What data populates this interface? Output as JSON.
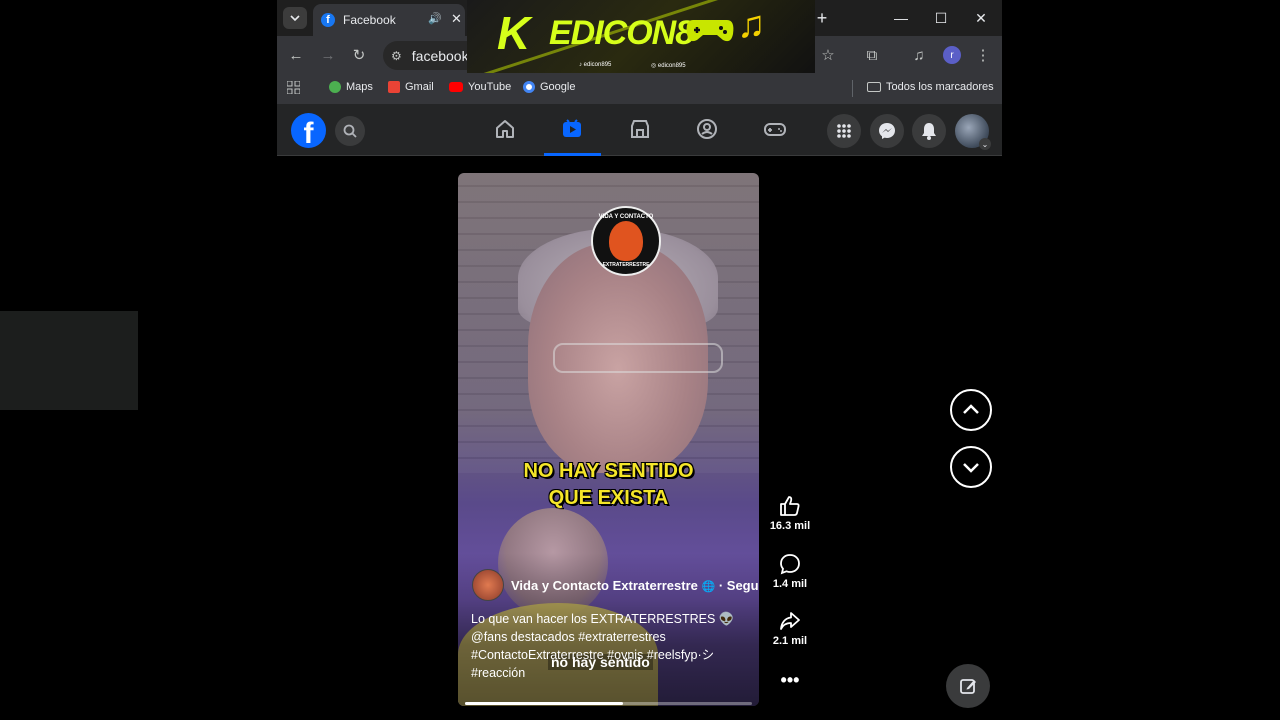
{
  "browser": {
    "tab_title": "Facebook",
    "url_partial": "facebook",
    "bookmarks": [
      {
        "label": "Maps",
        "color": "#4caf50"
      },
      {
        "label": "Gmail",
        "color": "#ea4335"
      },
      {
        "label": "YouTube",
        "color": "#ff0000"
      },
      {
        "label": "Google",
        "color": "#4285f4"
      }
    ],
    "all_bookmarks_label": "Todos los marcadores",
    "profile_initial": "r"
  },
  "overlay_banner": {
    "k": "K",
    "title": "EDICON8",
    "social_1": "edicon895",
    "social_2": "edicon895"
  },
  "facebook": {
    "logo": "f",
    "active_nav": "video"
  },
  "reel": {
    "badge_top": "VIDA Y CONTACTO",
    "badge_bottom": "EXTRATERRESTRE",
    "caption_line1": "NO HAY SENTIDO",
    "caption_line2": "QUE EXISTA",
    "subtitle_overlay": "no hay sentido",
    "author": "Vida y Contacto Extraterrestre",
    "follow_label": "· Seguir",
    "description": "Lo que van hacer los EXTRATERRESTRES 👽 @fans destacados #extraterrestres #ContactoExtraterrestre #ovnis #reelsfyp·シ #reacción",
    "progress": 0.55,
    "likes": "16.3 mil",
    "comments": "1.4 mil",
    "shares": "2.1 mil"
  }
}
